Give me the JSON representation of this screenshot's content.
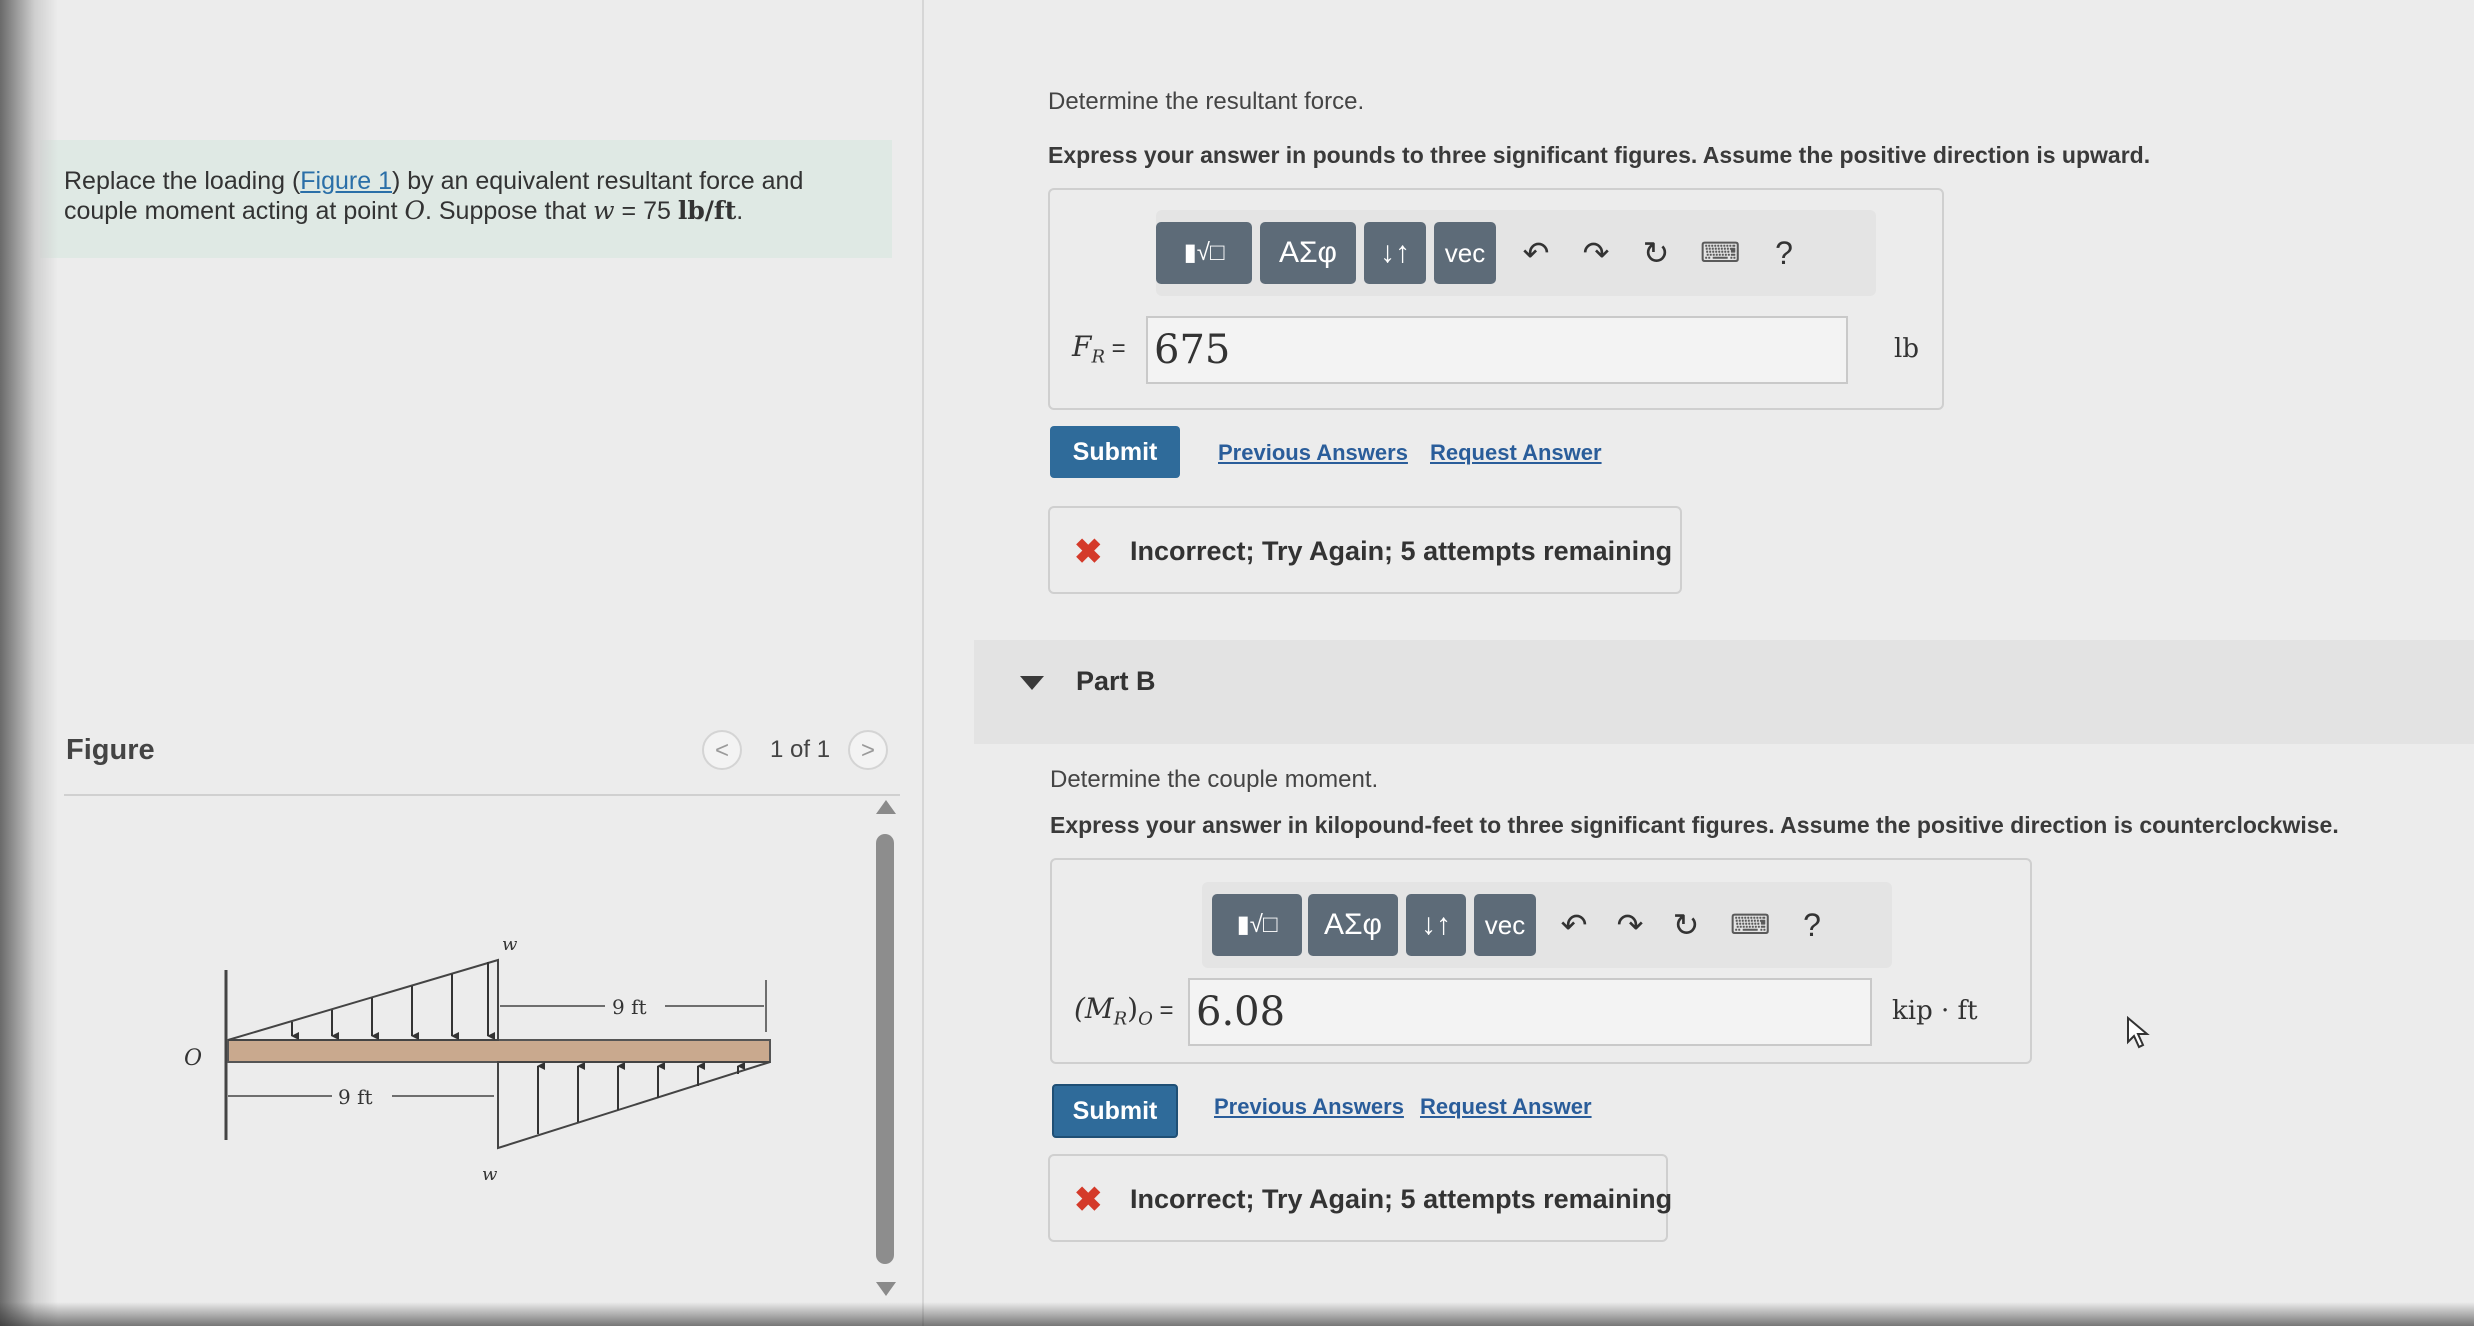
{
  "problem": {
    "text_before": "Replace the loading (",
    "figure_link": "Figure 1",
    "text_after": ") by an equivalent resultant force and",
    "line2_before": "couple moment acting at point ",
    "point": "O",
    "line2_mid": ". Suppose that ",
    "w_symbol": "w",
    "equals": " = 75 ",
    "units": "lb/ft",
    "period": "."
  },
  "figure": {
    "title": "Figure",
    "pager": "1 of 1",
    "prev_symbol": "<",
    "next_symbol": ">",
    "labels": {
      "w_top": "w",
      "w_bottom": "w",
      "dim_top": "9 ft",
      "dim_bottom": "9 ft",
      "point": "O"
    }
  },
  "part_a": {
    "prompt": "Determine the resultant force.",
    "instruction": "Express your answer in pounds to three significant figures. Assume the positive direction is upward.",
    "label_main": "F",
    "label_sub": "R",
    "label_eq": " =",
    "value": "675",
    "unit": "lb",
    "submit": "Submit",
    "previous_answers": "Previous Answers",
    "request_answer": "Request Answer",
    "feedback": "Incorrect; Try Again; 5 attempts remaining"
  },
  "part_b": {
    "title": "Part B",
    "prompt": "Determine the couple moment.",
    "instruction": "Express your answer in kilopound-feet to three significant figures. Assume the positive direction is counterclockwise.",
    "label_open": "(M",
    "label_sub": "R",
    "label_close": ")",
    "label_sub2": "O",
    "label_eq": " =",
    "value": "6.08",
    "unit": "kip · ft",
    "submit": "Submit",
    "previous_answers": "Previous Answers",
    "request_answer": "Request Answer",
    "feedback": "Incorrect; Try Again; 5 attempts remaining"
  },
  "toolbar": {
    "greek": "ΑΣφ",
    "arrows": "↓↑",
    "vec": "vec",
    "help": "?"
  },
  "colors": {
    "submit": "#2f6b9a",
    "toolbar_button": "#5d6b78",
    "error": "#d43a2a",
    "problem_bg": "#dfe9e4",
    "link": "#2a5d9a"
  }
}
